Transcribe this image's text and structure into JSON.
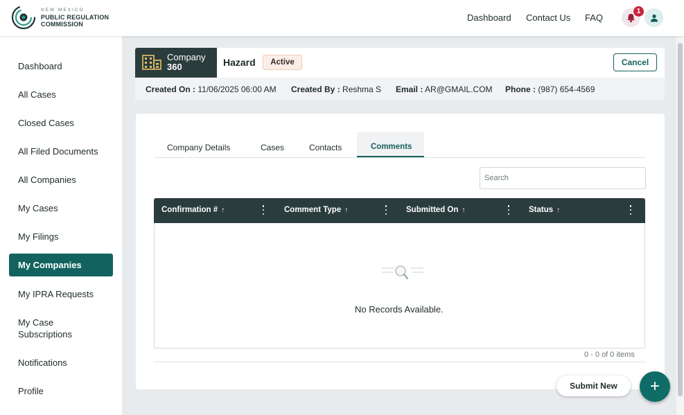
{
  "header": {
    "logo": {
      "line1": "NEW MEXICO",
      "line2": "PUBLIC REGULATION",
      "line3": "COMMISSION"
    },
    "nav": [
      "Dashboard",
      "Contact Us",
      "FAQ"
    ],
    "notification_count": "1",
    "icons": {
      "bell": "bell-icon",
      "user": "user-icon"
    }
  },
  "sidebar": {
    "items": [
      {
        "label": "Dashboard"
      },
      {
        "label": "All Cases"
      },
      {
        "label": "Closed Cases"
      },
      {
        "label": "All Filed Documents"
      },
      {
        "label": "All Companies"
      },
      {
        "label": "My Cases"
      },
      {
        "label": "My Filings"
      },
      {
        "label": "My Companies",
        "active": true
      },
      {
        "label": "My IPRA Requests"
      },
      {
        "label": "My Case",
        "label2": "Subscriptions"
      },
      {
        "label": "Notifications"
      },
      {
        "label": "Profile"
      }
    ]
  },
  "company": {
    "badge_label": "Company",
    "badge_number": "360",
    "name": "Hazard",
    "status": "Active",
    "cancel_label": "Cancel",
    "meta": {
      "created_on_label": "Created On :",
      "created_on": "11/06/2025 06:00 AM",
      "created_by_label": "Created By :",
      "created_by": "Reshma S",
      "email_label": "Email :",
      "email": "AR@GMAIL.COM",
      "phone_label": "Phone :",
      "phone": "(987) 654-4569"
    }
  },
  "tabs": [
    "Company Details",
    "Cases",
    "Contacts",
    "Comments"
  ],
  "active_tab": "Comments",
  "search": {
    "placeholder": "Search"
  },
  "grid": {
    "columns": [
      "Confirmation #",
      "Comment Type",
      "Submitted On",
      "Status"
    ],
    "sort_glyph": "↑",
    "empty_text": "No Records Available.",
    "pager": "0 - 0 of 0 items"
  },
  "actions": {
    "submit_label": "Submit New",
    "fab_label": "+"
  },
  "colors": {
    "primary": "#12635f",
    "header_dark": "#2b3c3d",
    "badge_red": "#c8253f"
  }
}
